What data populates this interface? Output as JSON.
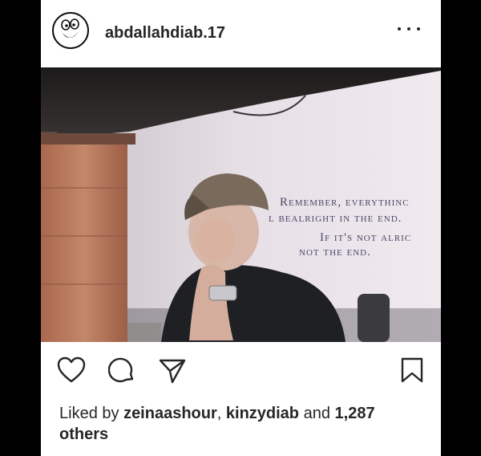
{
  "post": {
    "username": "abdallahdiab.17",
    "photo_text": {
      "line1": "Remember, everythinc",
      "line2": "l bealright in the end.",
      "line3": "If it's not alric",
      "line4": "not the end."
    },
    "likes": {
      "prefix": "Liked by",
      "user1": "zeinaashour",
      "separator": ",",
      "user2": "kinzydiab",
      "middle": "and",
      "count": "1,287",
      "others": "others"
    }
  },
  "icons": {
    "avatar": "cartoon-face-icon",
    "more": "more-options-icon",
    "like": "heart-icon",
    "comment": "comment-bubble-icon",
    "share": "paper-plane-icon",
    "save": "bookmark-icon"
  },
  "colors": {
    "text": "#262626",
    "background": "#ffffff",
    "letterbox": "#000000"
  }
}
